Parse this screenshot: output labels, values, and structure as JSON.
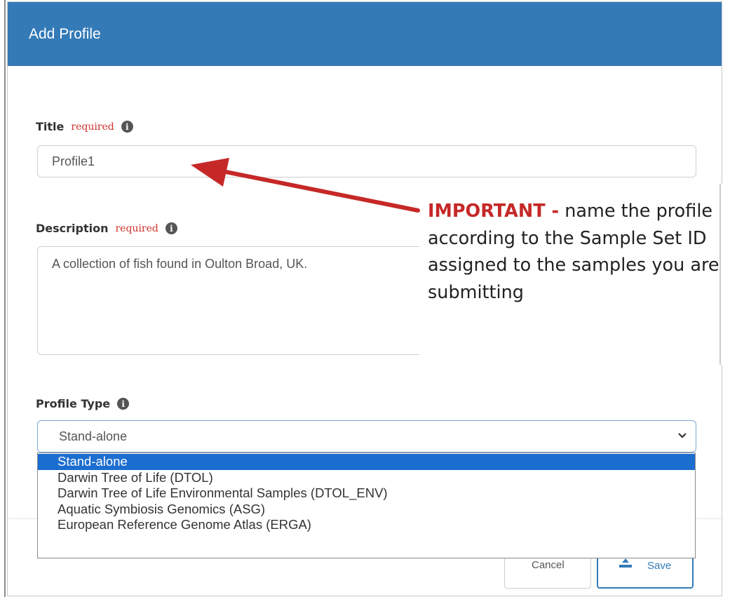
{
  "modal": {
    "title": "Add Profile"
  },
  "form": {
    "title_field": {
      "label": "Title",
      "required_text": "required",
      "value": "Profile1"
    },
    "description_field": {
      "label": "Description",
      "required_text": "required",
      "value": "A collection of fish found in Oulton Broad, UK."
    },
    "profile_type_field": {
      "label": "Profile Type",
      "selected": "Stand-alone",
      "options": [
        "Stand-alone",
        "Darwin Tree of Life (DTOL)",
        "Darwin Tree of Life Environmental Samples (DTOL_ENV)",
        "Aquatic Symbiosis Genomics (ASG)",
        "European Reference Genome Atlas (ERGA)"
      ]
    }
  },
  "footer": {
    "cancel_label": "Cancel",
    "save_label": "Save"
  },
  "annotation": {
    "important_label": "IMPORTANT -",
    "message": "name the profile according to the Sample Set ID assigned to the samples you are submitting"
  },
  "colors": {
    "header": "#337ab7",
    "required": "#d0312d",
    "selected_option": "#1c6dd0",
    "arrow": "#c62828"
  },
  "icons": [
    "info-icon",
    "chevron-down-icon",
    "upload-icon",
    "arrow-icon"
  ]
}
